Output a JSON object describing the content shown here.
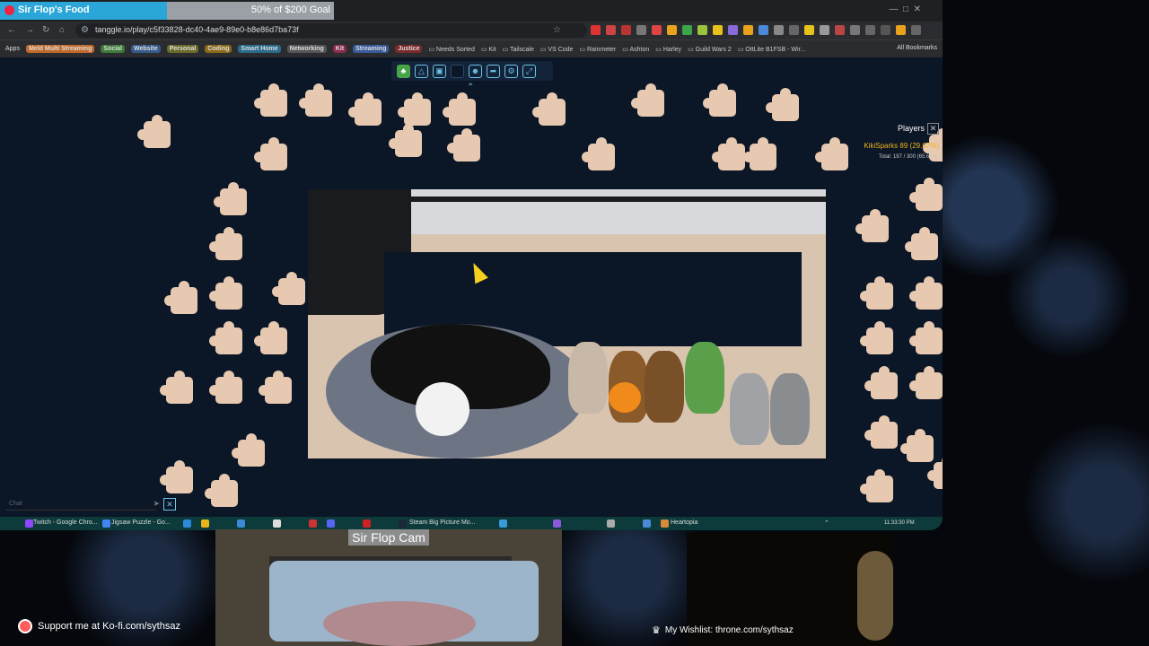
{
  "stream": {
    "goal_title": "Sir Flop's Food",
    "goal_text": "50% of $200 Goal",
    "goal_progress": 0.5,
    "cam_label": "Sir Flop Cam",
    "kofi_text": "Support me at Ko-fi.com/sythsaz",
    "wishlist_text": "My Wishlist: throne.com/sythsaz"
  },
  "browser": {
    "url": "tanggle.io/play/c5f33828-dc40-4ae9-89e0-b8e86d7ba73f",
    "bookmarks": [
      {
        "label": "Apps",
        "kind": "plain"
      },
      {
        "label": "Meld Multi Streaming",
        "kind": "tag",
        "color": "#c0692a"
      },
      {
        "label": "Social",
        "kind": "tag",
        "color": "#3d7a3a"
      },
      {
        "label": "Website",
        "kind": "tag",
        "color": "#355a8a"
      },
      {
        "label": "Personal",
        "kind": "tag",
        "color": "#6a6a2a"
      },
      {
        "label": "Coding",
        "kind": "tag",
        "color": "#8a6a1a"
      },
      {
        "label": "Smart Home",
        "kind": "tag",
        "color": "#2a6a8a"
      },
      {
        "label": "Networking",
        "kind": "tag",
        "color": "#555"
      },
      {
        "label": "Kit",
        "kind": "tag",
        "color": "#8a2a4a"
      },
      {
        "label": "Streaming",
        "kind": "tag",
        "color": "#3a5a9a"
      },
      {
        "label": "Justice",
        "kind": "tag",
        "color": "#7a2a2a"
      },
      {
        "label": "Needs Sorted",
        "kind": "folder"
      },
      {
        "label": "Kit",
        "kind": "folder"
      },
      {
        "label": "Tailscale",
        "kind": "folder"
      },
      {
        "label": "VS Code",
        "kind": "folder"
      },
      {
        "label": "Rainmeter",
        "kind": "folder"
      },
      {
        "label": "Ashton",
        "kind": "folder"
      },
      {
        "label": "Harley",
        "kind": "folder"
      },
      {
        "label": "Guild Wars 2",
        "kind": "folder"
      },
      {
        "label": "OttLite B1FSB - Wir...",
        "kind": "folder"
      }
    ],
    "all_bookmarks": "All Bookmarks"
  },
  "puzzle": {
    "players_title": "Players",
    "player_name": "KikiSparks",
    "player_score": "89 (29.67%)",
    "total": "Total: 197 / 300 (65.67%)",
    "chat_placeholder": "Chat",
    "tools": [
      "puzzle-icon",
      "shapes-icon",
      "image-icon",
      "square-icon",
      "people-icon",
      "share-icon",
      "settings-icon",
      "fullscreen-icon"
    ]
  },
  "taskbar": {
    "items": [
      "Twitch - Google Chro...",
      "Jigsaw Puzzle - Go...",
      "Steam Big Picture Mo...",
      "Heartopia"
    ],
    "clock": "11:33:30 PM"
  }
}
